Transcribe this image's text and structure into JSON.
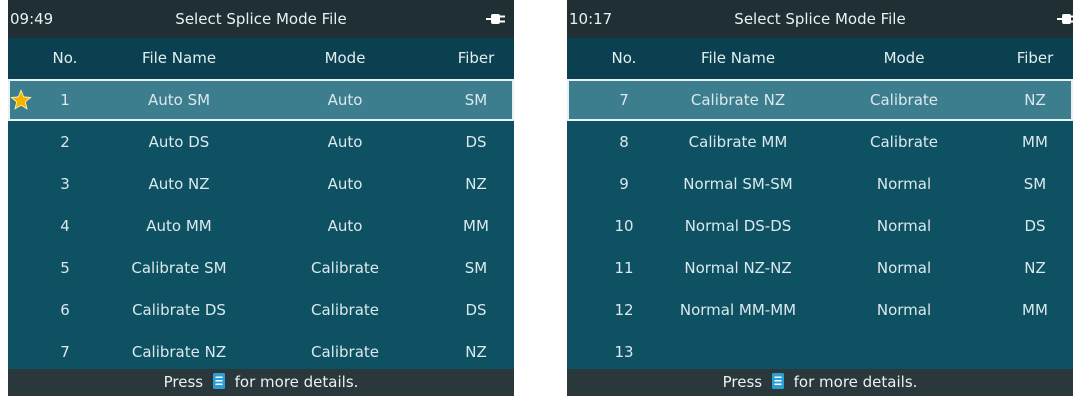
{
  "screens": [
    {
      "time": "09:49",
      "title": "Select Splice Mode File",
      "columns": {
        "no": "No.",
        "name": "File Name",
        "mode": "Mode",
        "fiber": "Fiber"
      },
      "rows": [
        {
          "no": "1",
          "name": "Auto SM",
          "mode": "Auto",
          "fiber": "SM",
          "selected": true,
          "starred": true
        },
        {
          "no": "2",
          "name": "Auto DS",
          "mode": "Auto",
          "fiber": "DS"
        },
        {
          "no": "3",
          "name": "Auto NZ",
          "mode": "Auto",
          "fiber": "NZ"
        },
        {
          "no": "4",
          "name": "Auto MM",
          "mode": "Auto",
          "fiber": "MM"
        },
        {
          "no": "5",
          "name": "Calibrate SM",
          "mode": "Calibrate",
          "fiber": "SM"
        },
        {
          "no": "6",
          "name": "Calibrate DS",
          "mode": "Calibrate",
          "fiber": "DS"
        },
        {
          "no": "7",
          "name": "Calibrate NZ",
          "mode": "Calibrate",
          "fiber": "NZ"
        }
      ],
      "footer": {
        "before": "Press",
        "after": "for more details."
      }
    },
    {
      "time": "10:17",
      "title": "Select Splice Mode File",
      "columns": {
        "no": "No.",
        "name": "File Name",
        "mode": "Mode",
        "fiber": "Fiber"
      },
      "rows": [
        {
          "no": "7",
          "name": "Calibrate NZ",
          "mode": "Calibrate",
          "fiber": "NZ",
          "selected": true
        },
        {
          "no": "8",
          "name": "Calibrate MM",
          "mode": "Calibrate",
          "fiber": "MM"
        },
        {
          "no": "9",
          "name": "Normal SM-SM",
          "mode": "Normal",
          "fiber": "SM"
        },
        {
          "no": "10",
          "name": "Normal DS-DS",
          "mode": "Normal",
          "fiber": "DS"
        },
        {
          "no": "11",
          "name": "Normal NZ-NZ",
          "mode": "Normal",
          "fiber": "NZ"
        },
        {
          "no": "12",
          "name": "Normal MM-MM",
          "mode": "Normal",
          "fiber": "MM"
        },
        {
          "no": "13",
          "name": "",
          "mode": "",
          "fiber": ""
        }
      ],
      "footer": {
        "before": "Press",
        "after": "for more details."
      }
    }
  ],
  "icons": {
    "plug": "power-plug-icon",
    "star": "star-icon",
    "details": "document-icon"
  },
  "colors": {
    "background": "#0e5162",
    "selected_row": "#3c7e8e",
    "title_bar": "#1f2f33",
    "footer": "#2a373b",
    "icon_blue": "#2a9fd6",
    "star": "#f5b300"
  }
}
